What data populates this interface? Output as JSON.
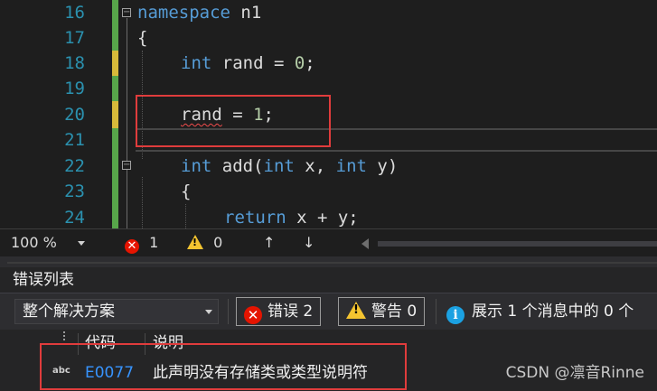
{
  "editor": {
    "lines": [
      {
        "num": "16"
      },
      {
        "num": "17"
      },
      {
        "num": "18"
      },
      {
        "num": "19"
      },
      {
        "num": "20"
      },
      {
        "num": "21"
      },
      {
        "num": "22"
      },
      {
        "num": "23"
      },
      {
        "num": "24"
      }
    ],
    "code": {
      "l16_kw": "namespace",
      "l16_rest": " n1",
      "l17": "{",
      "l18_kw": "int",
      "l18_mid": " rand = ",
      "l18_num": "0",
      "l18_end": ";",
      "l20_err": "rand",
      "l20_mid": " = ",
      "l20_num": "1",
      "l20_end": ";",
      "l22_kw1": "int",
      "l22_mid1": " add(",
      "l22_kw2": "int",
      "l22_mid2": " x, ",
      "l22_kw3": "int",
      "l22_end": " y)",
      "l23": "{",
      "l24_kw": "return",
      "l24_rest": " x + y;"
    },
    "colors": {
      "saved_change": "#57a64a",
      "unsaved_change": "#d7ba3a",
      "highlight_box": "#e03c3c"
    }
  },
  "statusbar": {
    "zoom": "100 %",
    "error_count": "1",
    "warning_count": "0",
    "up_arrow": "↑",
    "down_arrow": "↓",
    "error_icon_glyph": "✕",
    "warning_icon_glyph": "!"
  },
  "error_list": {
    "title": "错误列表",
    "scope": "整个解决方案",
    "errors_filter": "错误 2",
    "warnings_filter": "警告 0",
    "messages_filter": "展示 1 个消息中的 0 个",
    "info_icon_glyph": "i",
    "columns": {
      "code": "代码",
      "description": "说明"
    },
    "rows": [
      {
        "icon": "abc",
        "code": "E0077",
        "description": "此声明没有存储类或类型说明符"
      }
    ]
  },
  "watermark": "CSDN @凛音Rinne"
}
